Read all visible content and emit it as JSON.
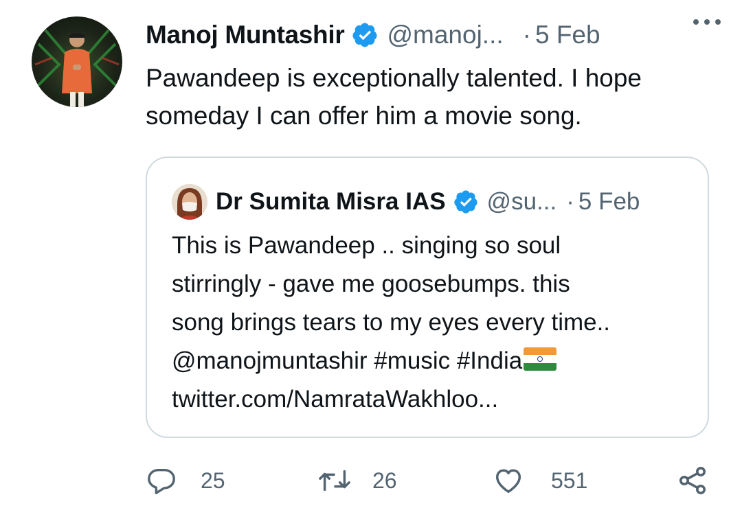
{
  "tweet": {
    "author_name": "Manoj Muntashir",
    "author_handle": "@manoj...",
    "separator": "·",
    "date": "5 Feb",
    "text": "Pawandeep is exceptionally talented. I hope someday I can offer him a movie song."
  },
  "quoted": {
    "author_name": "Dr Sumita Misra IAS",
    "author_handle": "@su...",
    "separator": "·",
    "date": "5 Feb",
    "line1": "This is Pawandeep .. singing so soul",
    "line2": "stirringly - gave me goosebumps. this",
    "line3": "song brings tears to my eyes every time..",
    "line4": "@manojmuntashir #music #India",
    "line5": "twitter.com/NamrataWakhloo..."
  },
  "actions": {
    "reply_count": "25",
    "retweet_count": "26",
    "like_count": "551"
  },
  "colors": {
    "verified_blue": "#1d9bf0",
    "secondary_text": "#536471",
    "border": "#cfd9de"
  },
  "icons": [
    "more-icon",
    "verified-icon",
    "reply-icon",
    "retweet-icon",
    "like-icon",
    "share-icon",
    "india-flag-emoji"
  ]
}
